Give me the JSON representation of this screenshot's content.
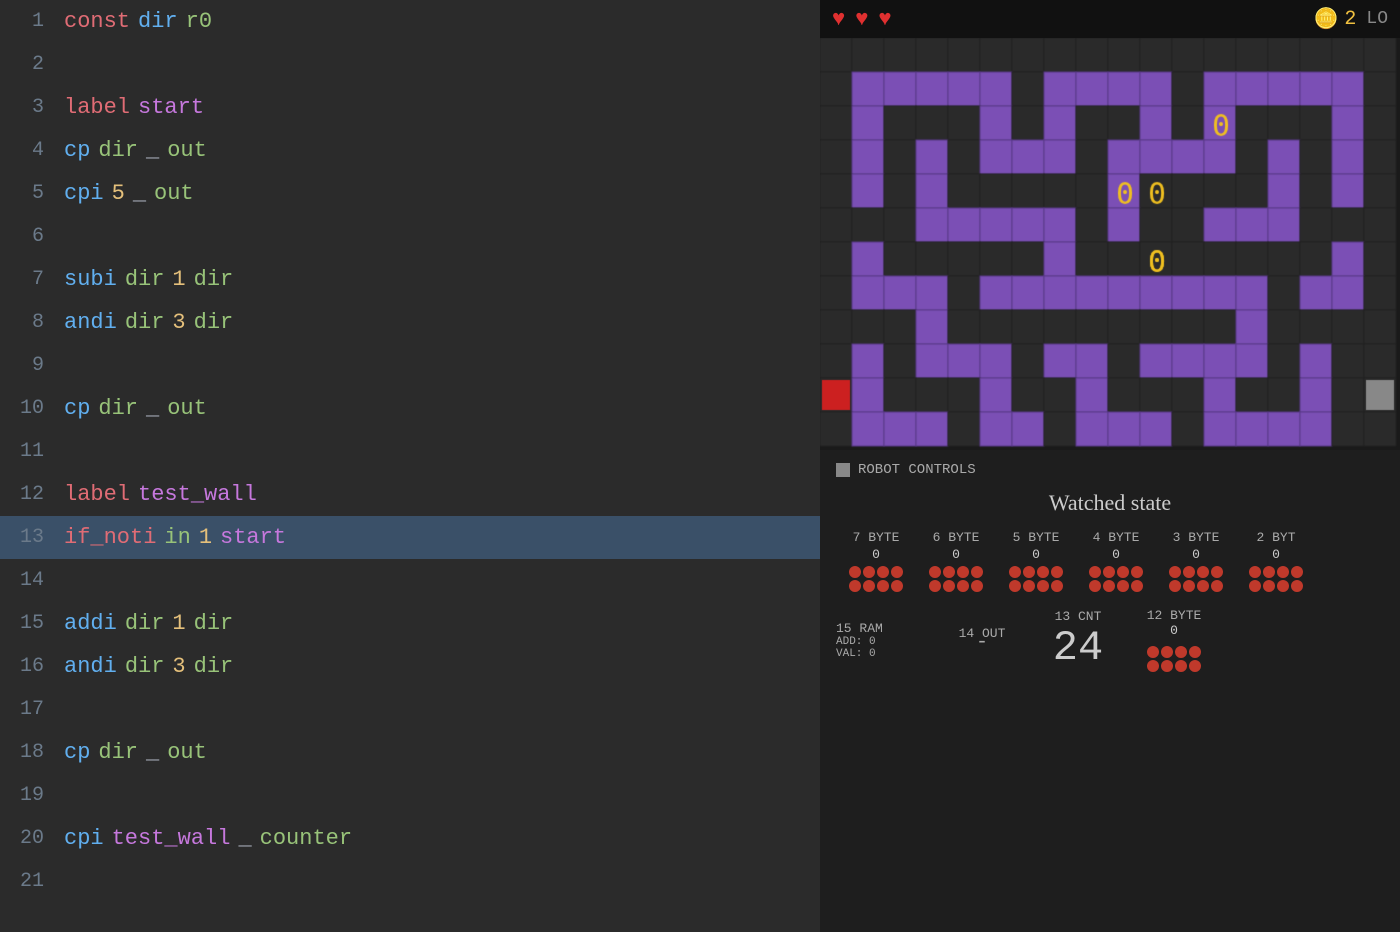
{
  "editor": {
    "lines": [
      {
        "num": 1,
        "tokens": [
          {
            "t": "t-keyword",
            "v": "const"
          },
          {
            "t": "t-instr",
            "v": "dir"
          },
          {
            "t": "t-reg",
            "v": "r0"
          }
        ],
        "highlighted": false
      },
      {
        "num": 2,
        "tokens": [],
        "highlighted": false
      },
      {
        "num": 3,
        "tokens": [
          {
            "t": "t-keyword",
            "v": "label"
          },
          {
            "t": "t-label",
            "v": "start"
          }
        ],
        "highlighted": false
      },
      {
        "num": 4,
        "tokens": [
          {
            "t": "t-instr",
            "v": "cp"
          },
          {
            "t": "t-reg",
            "v": "dir"
          },
          {
            "t": "t-underscore",
            "v": "_"
          },
          {
            "t": "t-reg",
            "v": "out"
          }
        ],
        "highlighted": false
      },
      {
        "num": 5,
        "tokens": [
          {
            "t": "t-instr",
            "v": "cpi"
          },
          {
            "t": "t-num",
            "v": "5"
          },
          {
            "t": "t-underscore",
            "v": "_"
          },
          {
            "t": "t-reg",
            "v": "out"
          }
        ],
        "highlighted": false
      },
      {
        "num": 6,
        "tokens": [],
        "highlighted": false
      },
      {
        "num": 7,
        "tokens": [
          {
            "t": "t-instr",
            "v": "subi"
          },
          {
            "t": "t-reg",
            "v": "dir"
          },
          {
            "t": "t-num",
            "v": "1"
          },
          {
            "t": "t-reg",
            "v": "dir"
          }
        ],
        "highlighted": false
      },
      {
        "num": 8,
        "tokens": [
          {
            "t": "t-instr",
            "v": "andi"
          },
          {
            "t": "t-reg",
            "v": "dir"
          },
          {
            "t": "t-num",
            "v": "3"
          },
          {
            "t": "t-reg",
            "v": "dir"
          }
        ],
        "highlighted": false
      },
      {
        "num": 9,
        "tokens": [],
        "highlighted": false
      },
      {
        "num": 10,
        "tokens": [
          {
            "t": "t-instr",
            "v": "cp"
          },
          {
            "t": "t-reg",
            "v": "dir"
          },
          {
            "t": "t-underscore",
            "v": "_"
          },
          {
            "t": "t-reg",
            "v": "out"
          }
        ],
        "highlighted": false
      },
      {
        "num": 11,
        "tokens": [],
        "highlighted": false
      },
      {
        "num": 12,
        "tokens": [
          {
            "t": "t-keyword",
            "v": "label"
          },
          {
            "t": "t-label",
            "v": "test_wall"
          }
        ],
        "highlighted": false
      },
      {
        "num": 13,
        "tokens": [
          {
            "t": "t-keyword",
            "v": "if_noti"
          },
          {
            "t": "t-reg",
            "v": "in"
          },
          {
            "t": "t-num",
            "v": "1"
          },
          {
            "t": "t-label",
            "v": "start"
          }
        ],
        "highlighted": true
      },
      {
        "num": 14,
        "tokens": [],
        "highlighted": false
      },
      {
        "num": 15,
        "tokens": [
          {
            "t": "t-instr",
            "v": "addi"
          },
          {
            "t": "t-reg",
            "v": "dir"
          },
          {
            "t": "t-num",
            "v": "1"
          },
          {
            "t": "t-reg",
            "v": "dir"
          }
        ],
        "highlighted": false
      },
      {
        "num": 16,
        "tokens": [
          {
            "t": "t-instr",
            "v": "andi"
          },
          {
            "t": "t-reg",
            "v": "dir"
          },
          {
            "t": "t-num",
            "v": "3"
          },
          {
            "t": "t-reg",
            "v": "dir"
          }
        ],
        "highlighted": false
      },
      {
        "num": 17,
        "tokens": [],
        "highlighted": false
      },
      {
        "num": 18,
        "tokens": [
          {
            "t": "t-instr",
            "v": "cp"
          },
          {
            "t": "t-reg",
            "v": "dir"
          },
          {
            "t": "t-underscore",
            "v": "_"
          },
          {
            "t": "t-reg",
            "v": "out"
          }
        ],
        "highlighted": false
      },
      {
        "num": 19,
        "tokens": [],
        "highlighted": false
      },
      {
        "num": 20,
        "tokens": [
          {
            "t": "t-instr",
            "v": "cpi"
          },
          {
            "t": "t-label",
            "v": "test_wall"
          },
          {
            "t": "t-underscore",
            "v": "_"
          },
          {
            "t": "t-reg",
            "v": "counter"
          }
        ],
        "highlighted": false
      },
      {
        "num": 21,
        "tokens": [],
        "highlighted": false
      }
    ]
  },
  "hud": {
    "hearts": 3,
    "coins": 2,
    "lo_text": "LO"
  },
  "controls": {
    "header": "ROBOT CONTROLS",
    "watched_state": "Watched state"
  },
  "registers": {
    "top_row": [
      {
        "label": "7 BYTE",
        "value": "0",
        "dots": [
          true,
          true,
          true,
          true,
          true,
          true,
          true,
          true
        ]
      },
      {
        "label": "6 BYTE",
        "value": "0",
        "dots": [
          true,
          true,
          true,
          true,
          true,
          true,
          true,
          true
        ]
      },
      {
        "label": "5 BYTE",
        "value": "0",
        "dots": [
          true,
          true,
          true,
          true,
          true,
          true,
          true,
          true
        ]
      },
      {
        "label": "4 BYTE",
        "value": "0",
        "dots": [
          true,
          true,
          true,
          true,
          true,
          true,
          true,
          true
        ]
      },
      {
        "label": "3 BYTE",
        "value": "0",
        "dots": [
          true,
          true,
          true,
          true,
          true,
          true,
          true,
          true
        ]
      },
      {
        "label": "2 BYT",
        "value": "0",
        "dots": [
          true,
          true,
          true,
          true,
          true,
          true,
          true,
          true
        ]
      }
    ],
    "bottom_row": {
      "ram": {
        "label": "15 RAM",
        "add": "ADD: 0",
        "val": "VAL: 0"
      },
      "out": {
        "label": "14 OUT",
        "dash": "-"
      },
      "cnt": {
        "label": "13 CNT",
        "value": "24"
      },
      "byte": {
        "label": "12 BYTE",
        "value": "0",
        "dots": [
          true,
          true,
          true,
          true,
          true,
          true,
          true,
          true
        ]
      }
    }
  }
}
